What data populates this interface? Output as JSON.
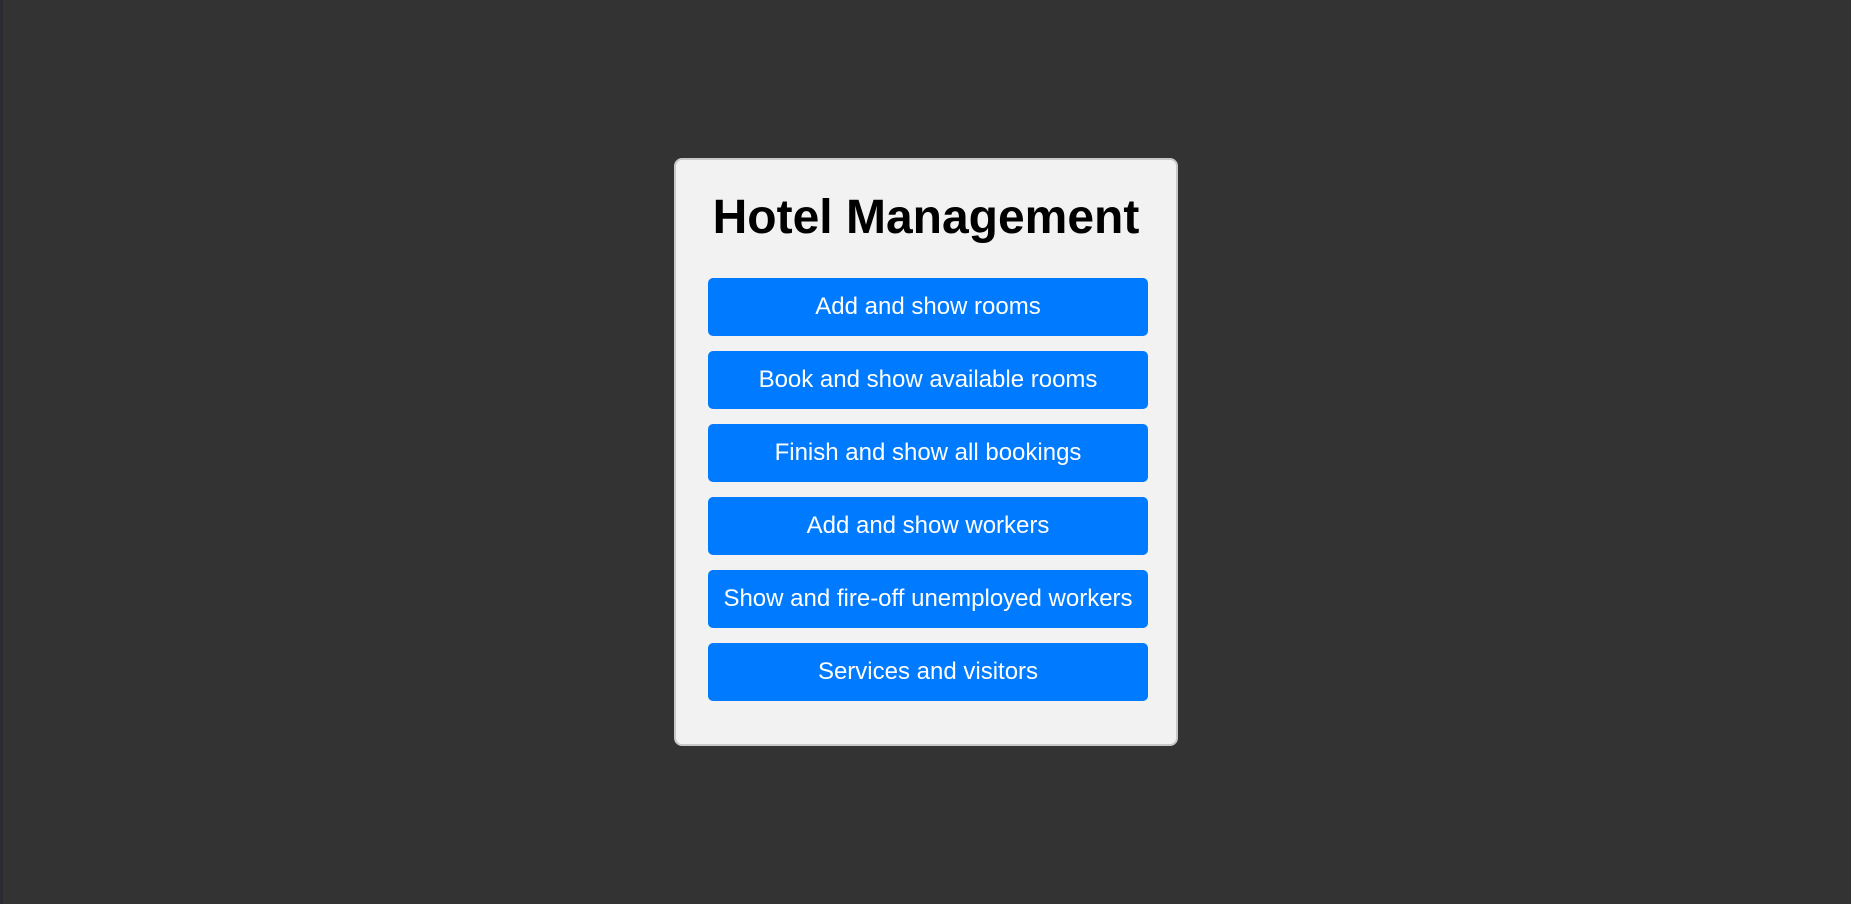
{
  "colors": {
    "page_background": "#333333",
    "panel_background": "#f2f2f2",
    "panel_border": "#c8c8c8",
    "button_background": "#007bff",
    "button_text": "#ffffff",
    "title_text": "#000000"
  },
  "panel": {
    "title": "Hotel Management",
    "buttons": [
      {
        "label": "Add and show rooms"
      },
      {
        "label": "Book and show available rooms"
      },
      {
        "label": "Finish and show all bookings"
      },
      {
        "label": "Add and show workers"
      },
      {
        "label": "Show and fire-off unemployed workers"
      },
      {
        "label": "Services and visitors"
      }
    ]
  }
}
